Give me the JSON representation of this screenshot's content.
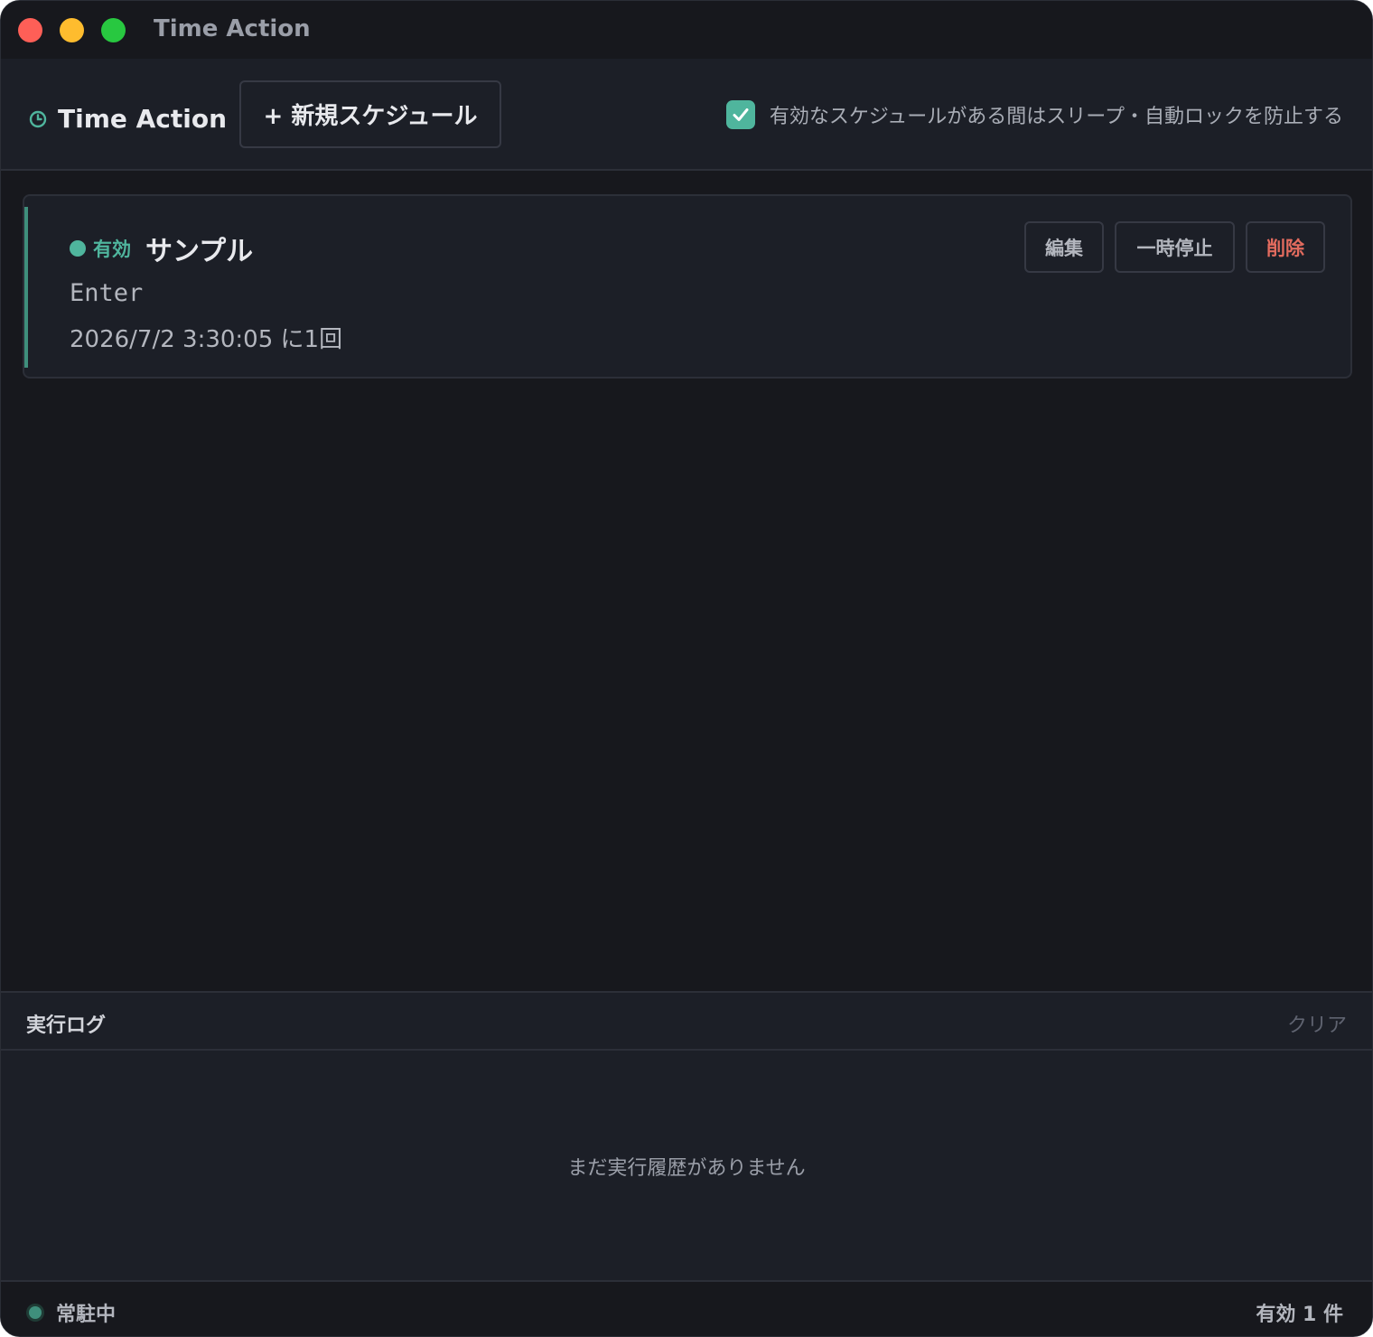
{
  "window": {
    "title": "Time Action"
  },
  "toolbar": {
    "brand_icon": "clock-icon",
    "brand_name": "Time Action",
    "new_schedule_label": "+ 新規スケジュール",
    "prevent_sleep_checked": true,
    "prevent_sleep_label": "有効なスケジュールがある間はスリープ・自動ロックを防止する"
  },
  "schedules": [
    {
      "status": "有効",
      "name": "サンプル",
      "key": "Enter",
      "when": "2026/7/2 3:30:05 に1回",
      "actions": {
        "edit": "編集",
        "pause": "一時停止",
        "delete": "削除"
      }
    }
  ],
  "log": {
    "title": "実行ログ",
    "clear_label": "クリア",
    "empty_message": "まだ実行履歴がありません"
  },
  "statusbar": {
    "resident_label": "常駐中",
    "active_count_label": "有効 1 件"
  },
  "colors": {
    "accent": "#4fb59d",
    "danger": "#e26b5e",
    "background": "#17181d",
    "panel": "#1c1f27"
  }
}
